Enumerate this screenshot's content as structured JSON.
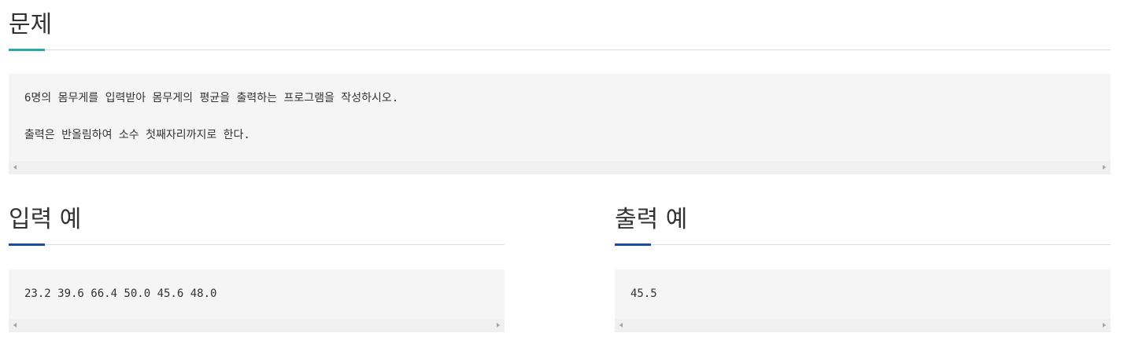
{
  "problem": {
    "title": "문제",
    "accent_color": "#2aa9a9",
    "lines": [
      "6명의 몸무게를 입력받아 몸무게의 평균을 출력하는 프로그램을 작성하시오.",
      "출력은 반올림하여 소수 첫째자리까지로 한다."
    ]
  },
  "input_example": {
    "title": "입력 예",
    "accent_color": "#1d4e9e",
    "content": "23.2 39.6 66.4 50.0 45.6 48.0"
  },
  "output_example": {
    "title": "출력 예",
    "accent_color": "#1d4e9e",
    "content": "45.5"
  },
  "icons": {
    "scroll_left": "scroll-left-arrow-icon",
    "scroll_right": "scroll-right-arrow-icon"
  }
}
